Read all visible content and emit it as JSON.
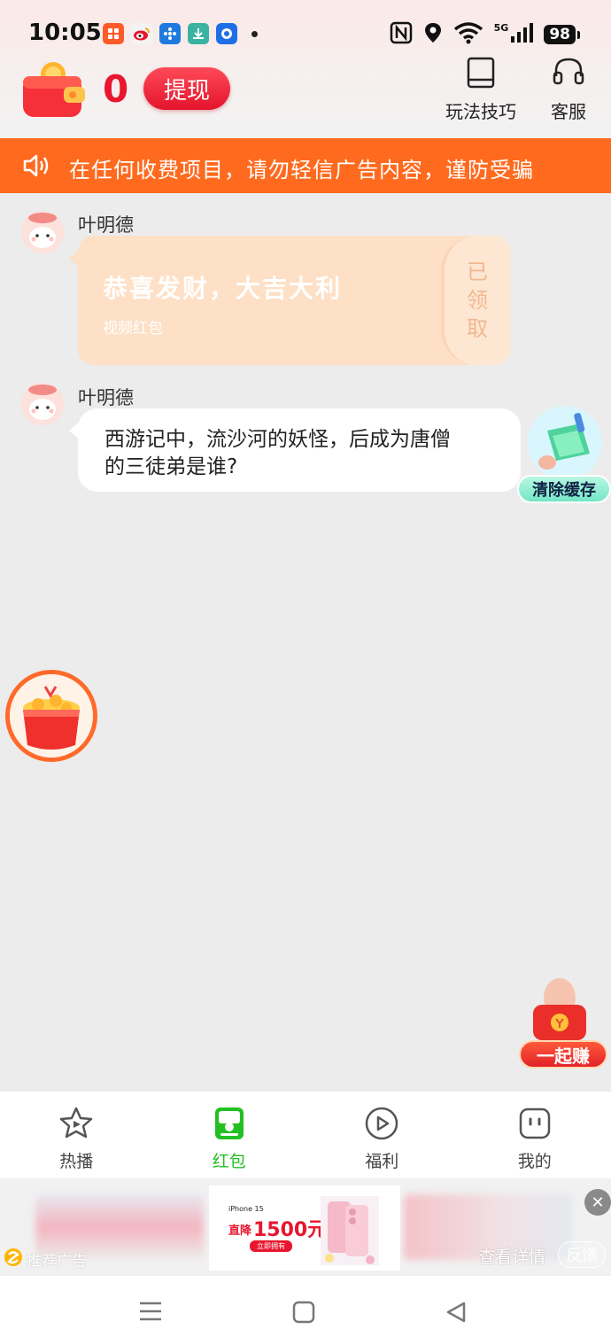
{
  "status_bar": {
    "time": "10:05",
    "network": "5G",
    "battery": "98",
    "notification_icons": [
      "xiaohongshu-icon",
      "weibo-icon",
      "pinwheel-app-icon",
      "download-icon",
      "browser-icon"
    ]
  },
  "header": {
    "balance": "0",
    "withdraw_label": "提现",
    "tips_label": "玩法技巧",
    "service_label": "客服"
  },
  "notice": {
    "text": "在任何收费项目，请勿轻信广告内容，谨防受骗"
  },
  "messages": [
    {
      "sender": "叶明德",
      "type": "red_packet",
      "title": "恭喜发财，大吉大利",
      "subtitle": "视频红包",
      "status": "已领取",
      "status_chars": [
        "已",
        "领",
        "取"
      ]
    },
    {
      "sender": "叶明德",
      "type": "text",
      "text_line1": "西游记中，流沙河的妖怪，后成为唐僧",
      "text_line2": "的三徒弟是谁?"
    }
  ],
  "floating": {
    "clear_cache_label": "清除缓存",
    "earn_label": "一起赚"
  },
  "tabs": [
    {
      "label": "热播",
      "icon": "star-play-icon",
      "active": false
    },
    {
      "label": "红包",
      "icon": "red-packet-icon",
      "active": true
    },
    {
      "label": "福利",
      "icon": "play-circle-icon",
      "active": false
    },
    {
      "label": "我的",
      "icon": "profile-box-icon",
      "active": false
    }
  ],
  "ad": {
    "product": "iPhone 15",
    "price_prefix": "直降",
    "price": "1500元",
    "cta": "立即拥有",
    "tag": "推荐广告",
    "detail": "查看详情",
    "feedback": "反馈"
  },
  "colors": {
    "accent_red": "#e8172f",
    "notice_orange": "#ff6a1e",
    "tab_active_green": "#23c023",
    "red_packet_bg": "#fde0c6"
  }
}
